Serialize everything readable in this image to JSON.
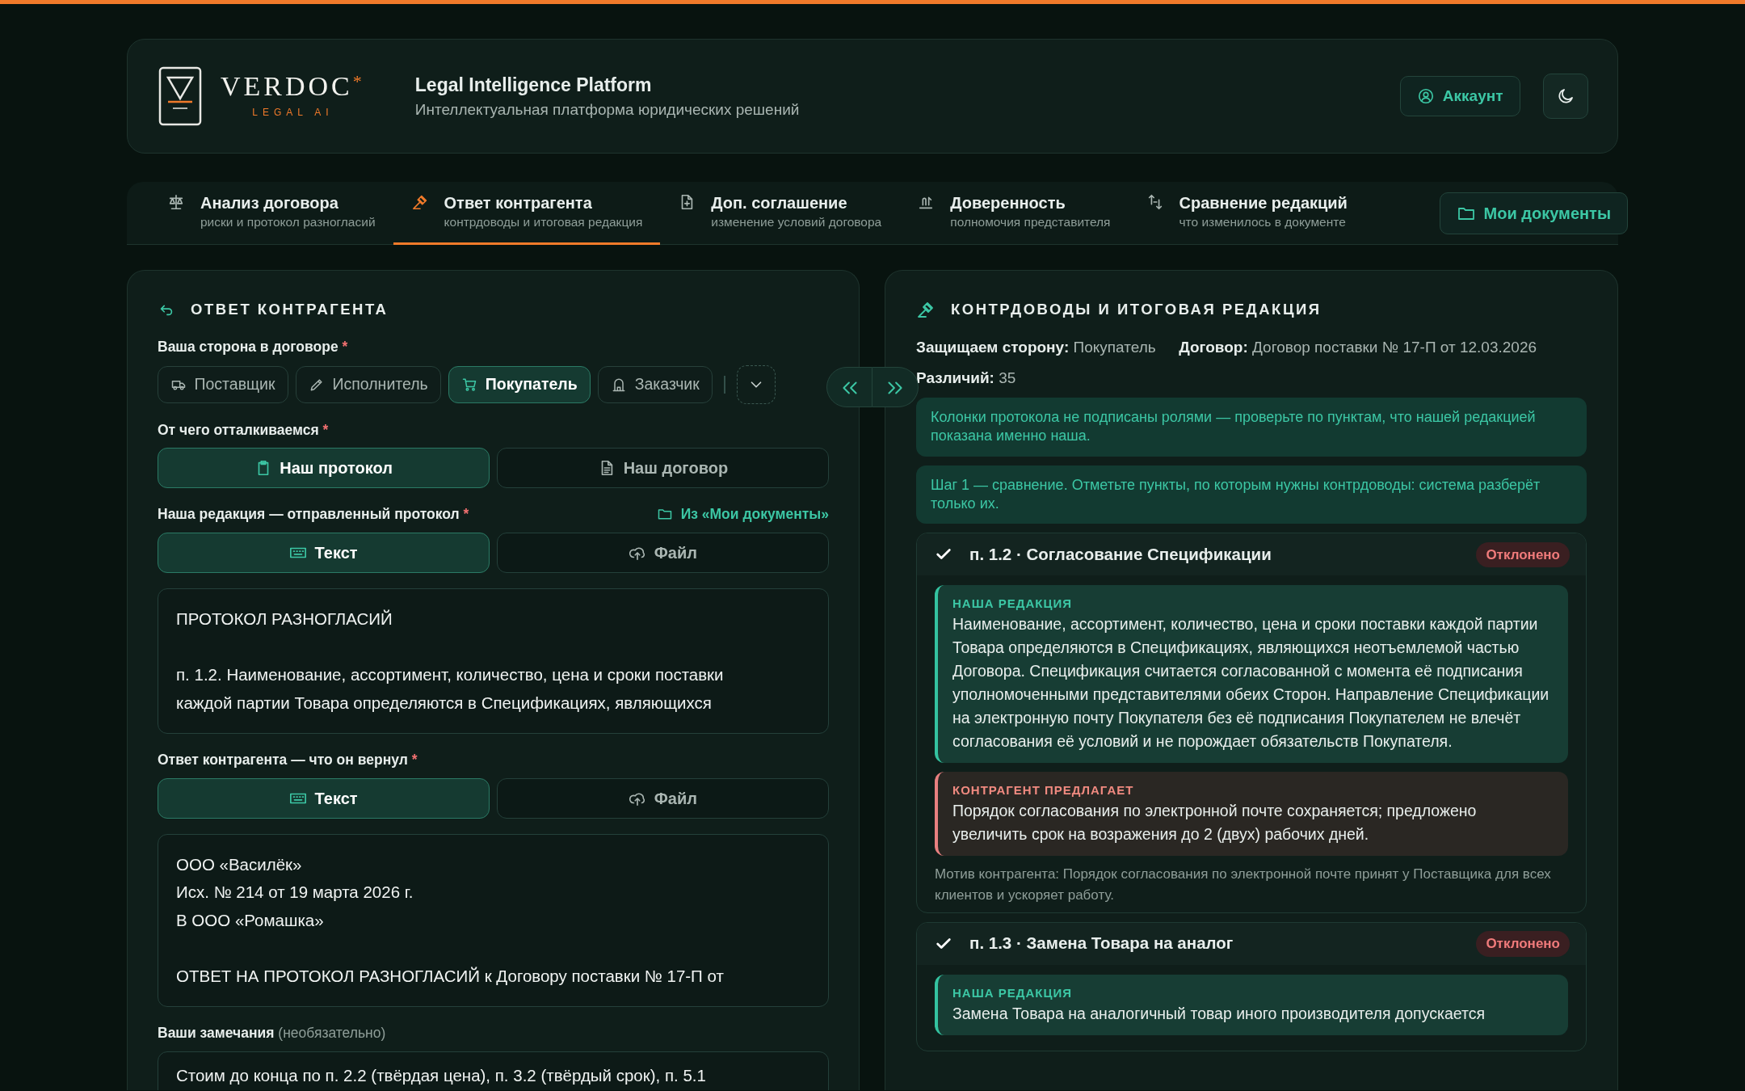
{
  "brand": {
    "name": "VERDOC",
    "mark": "*",
    "tagline": "LEGAL AI"
  },
  "header": {
    "title": "Legal Intelligence Platform",
    "subtitle": "Интеллектуальная платформа юридических решений",
    "account_button": "Аккаунт"
  },
  "tabs": [
    {
      "title": "Анализ договора",
      "subtitle": "риски и протокол разногласий",
      "selected": false
    },
    {
      "title": "Ответ контрагента",
      "subtitle": "контрдоводы и итоговая редакция",
      "selected": true
    },
    {
      "title": "Доп. соглашение",
      "subtitle": "изменение условий договора",
      "selected": false
    },
    {
      "title": "Доверенность",
      "subtitle": "полномочия представителя",
      "selected": false
    },
    {
      "title": "Сравнение редакций",
      "subtitle": "что изменилось в документе",
      "selected": false
    }
  ],
  "documents_button": "Мои документы",
  "left_panel": {
    "title": "ОТВЕТ КОНТРАГЕНТА",
    "side": {
      "label": "Ваша сторона в договоре",
      "required_mark": "*",
      "roles": [
        {
          "label": "Поставщик",
          "selected": false
        },
        {
          "label": "Исполнитель",
          "selected": false
        },
        {
          "label": "Покупатель",
          "selected": true
        },
        {
          "label": "Заказчик",
          "selected": false
        }
      ]
    },
    "basis": {
      "label": "От чего отталкиваемся",
      "required_mark": "*",
      "options": [
        {
          "label": "Наш протокол",
          "selected": true
        },
        {
          "label": "Наш договор",
          "selected": false
        }
      ]
    },
    "inputs": [
      {
        "label": "Наша редакция — отправленный протокол",
        "required_mark": "*",
        "link": "Из «Мои документы»",
        "modes": [
          {
            "label": "Текст",
            "selected": true
          },
          {
            "label": "Файл",
            "selected": false
          }
        ],
        "text": "ПРОТОКОЛ РАЗНОГЛАСИЙ\n\nп. 1.2. Наименование, ассортимент, количество, цена и сроки поставки\nкаждой партии Товара определяются в Спецификациях, являющихся"
      },
      {
        "label": "Ответ контрагента — что он вернул",
        "required_mark": "*",
        "modes": [
          {
            "label": "Текст",
            "selected": true
          },
          {
            "label": "Файл",
            "selected": false
          }
        ],
        "text": "ООО «Василёк»\nИсх. № 214 от 19 марта 2026 г.\nВ ООО «Ромашка»\n\nОТВЕТ НА ПРОТОКОЛ РАЗНОГЛАСИЙ к Договору поставки № 17-П от"
      }
    ],
    "remarks": {
      "label": "Ваши замечания",
      "hint": "(необязательно)",
      "text": "Стоим до конца по п. 2.2 (твёрдая цена), п. 3.2 (твёрдый срок), п. 5.1"
    }
  },
  "right_panel": {
    "title": "КОНТРДОВОДЫ И ИТОГОВАЯ РЕДАКЦИЯ",
    "meta": [
      [
        {
          "label": "Защищаем сторону:",
          "value": "Покупатель"
        },
        {
          "label": "Договор:",
          "value": "Договор поставки № 17-П от 12.03.2026"
        }
      ],
      [
        {
          "label": "Различий:",
          "value": "35"
        }
      ]
    ],
    "notices": [
      "Колонки протокола не подписаны ролями — проверьте по пунктам, что нашей редакцией показана именно наша.",
      "Шаг 1 — сравнение. Отметьте пункты, по которым нужны контрдоводы: система разберёт только их."
    ],
    "items": [
      {
        "checked": true,
        "title": "**п. 1.2** · Согласование Спецификации",
        "status": "Отклонено",
        "ours_label": "НАША РЕДАКЦИЯ",
        "ours": "Наименование, ассортимент, количество, цена и сроки поставки каждой партии Товара определяются в Спецификациях, являющихся неотъемлемой частью Договора. Спецификация считается согласованной с момента её подписания уполномоченными представителями обеих Сторон. Направление Спецификации на электронную почту Покупателя без её подписания Покупателем не влечёт согласования её условий и не порождает обязательств Покупателя.",
        "counter_label": "КОНТРАГЕНТ ПРЕДЛАГАЕТ",
        "counter": "Порядок согласования по электронной почте сохраняется; предложено увеличить срок на возражения до 2 (двух) рабочих дней.",
        "motive": "Мотив контрагента: Порядок согласования по электронной почте принят у Поставщика для всех клиентов и ускоряет работу."
      },
      {
        "checked": true,
        "title": "**п. 1.3** · Замена Товара на аналог",
        "status": "Отклонено",
        "ours_label": "НАША РЕДАКЦИЯ",
        "ours": "Замена Товара на аналогичный товар иного производителя допускается"
      }
    ]
  }
}
